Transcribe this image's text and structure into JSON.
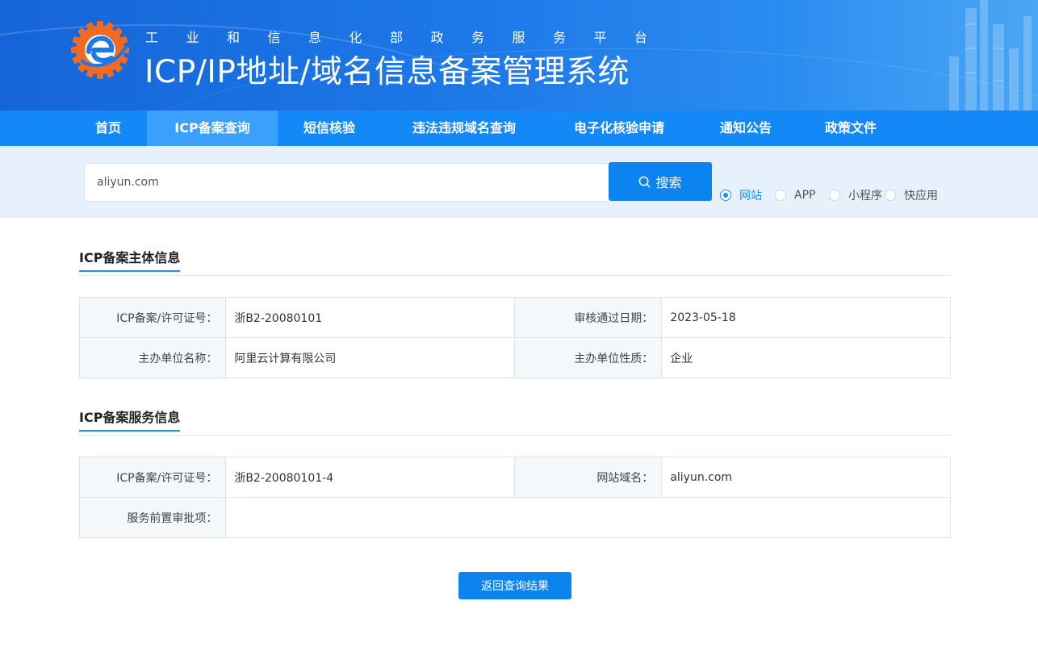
{
  "header": {
    "subtitle": "工业和信息化部政务服务平台",
    "title": "ICP/IP地址/域名信息备案管理系统"
  },
  "nav": {
    "items": [
      {
        "label": "首页",
        "active": false
      },
      {
        "label": "ICP备案查询",
        "active": true
      },
      {
        "label": "短信核验",
        "active": false
      },
      {
        "label": "违法违规域名查询",
        "active": false
      },
      {
        "label": "电子化核验申请",
        "active": false
      },
      {
        "label": "通知公告",
        "active": false
      },
      {
        "label": "政策文件",
        "active": false
      }
    ]
  },
  "search": {
    "value": "aliyun.com",
    "button_label": "搜索",
    "options": [
      {
        "label": "网站",
        "checked": true
      },
      {
        "label": "APP",
        "checked": false
      },
      {
        "label": "小程序",
        "checked": false
      },
      {
        "label": "快应用",
        "checked": false
      }
    ]
  },
  "subject_info": {
    "title": "ICP备案主体信息",
    "rows": [
      {
        "label1": "ICP备案/许可证号：",
        "value1": "浙B2-20080101",
        "label2": "审核通过日期：",
        "value2": "2023-05-18"
      },
      {
        "label1": "主办单位名称：",
        "value1": "阿里云计算有限公司",
        "label2": "主办单位性质：",
        "value2": "企业"
      }
    ]
  },
  "service_info": {
    "title": "ICP备案服务信息",
    "row1": {
      "label1": "ICP备案/许可证号：",
      "value1": "浙B2-20080101-4",
      "label2": "网站域名：",
      "value2": "aliyun.com"
    },
    "row2": {
      "label": "服务前置审批项：",
      "value": ""
    }
  },
  "back_button": "返回查询结果",
  "colors": {
    "primary": "#1289f7",
    "header": "#1d78e8",
    "accent": "#1890ff"
  }
}
